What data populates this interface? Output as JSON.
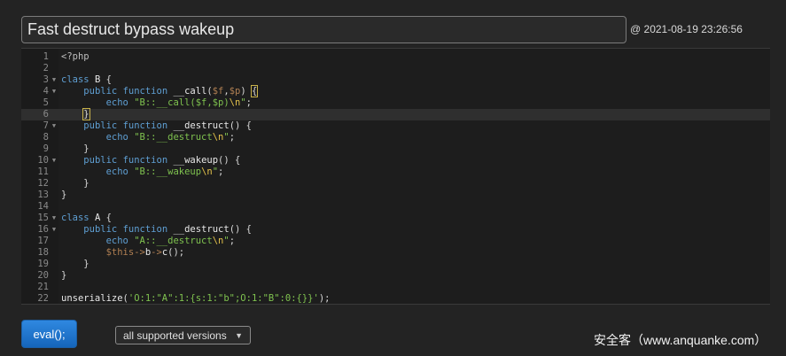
{
  "header": {
    "title": "Fast destruct bypass wakeup",
    "timestamp": "@ 2021-08-19 23:26:56"
  },
  "editor": {
    "active_line": 6,
    "lines": [
      {
        "n": "1",
        "fold": false,
        "text": "<?php"
      },
      {
        "n": "2",
        "fold": false,
        "text": ""
      },
      {
        "n": "3",
        "fold": true,
        "text": "class B {"
      },
      {
        "n": "4",
        "fold": true,
        "text": "    public function __call($f,$p) {"
      },
      {
        "n": "5",
        "fold": false,
        "text": "        echo \"B::__call($f,$p)\\n\";"
      },
      {
        "n": "6",
        "fold": false,
        "text": "    }"
      },
      {
        "n": "7",
        "fold": true,
        "text": "    public function __destruct() {"
      },
      {
        "n": "8",
        "fold": false,
        "text": "        echo \"B::__destruct\\n\";"
      },
      {
        "n": "9",
        "fold": false,
        "text": "    }"
      },
      {
        "n": "10",
        "fold": true,
        "text": "    public function __wakeup() {"
      },
      {
        "n": "11",
        "fold": false,
        "text": "        echo \"B::__wakeup\\n\";"
      },
      {
        "n": "12",
        "fold": false,
        "text": "    }"
      },
      {
        "n": "13",
        "fold": false,
        "text": "}"
      },
      {
        "n": "14",
        "fold": false,
        "text": ""
      },
      {
        "n": "15",
        "fold": true,
        "text": "class A {"
      },
      {
        "n": "16",
        "fold": true,
        "text": "    public function __destruct() {"
      },
      {
        "n": "17",
        "fold": false,
        "text": "        echo \"A::__destruct\\n\";"
      },
      {
        "n": "18",
        "fold": false,
        "text": "        $this->b->c();"
      },
      {
        "n": "19",
        "fold": false,
        "text": "    }"
      },
      {
        "n": "20",
        "fold": false,
        "text": "}"
      },
      {
        "n": "21",
        "fold": false,
        "text": ""
      },
      {
        "n": "22",
        "fold": false,
        "text": "unserialize('O:1:\"A\":1:{s:1:\"b\";O:1:\"B\":0:{}}');"
      }
    ]
  },
  "footer": {
    "eval_label": "eval();",
    "version_selected": "all supported versions",
    "watermark": "安全客（www.anquanke.com）"
  },
  "colors": {
    "keyword": "#5f9fd3",
    "string": "#7fc24f",
    "variable": "#b07f52",
    "escape": "#e3c14a",
    "button": "#1f74cf"
  },
  "icons": {
    "fold": "fold-arrow-icon",
    "select": "chevron-down-icon"
  }
}
